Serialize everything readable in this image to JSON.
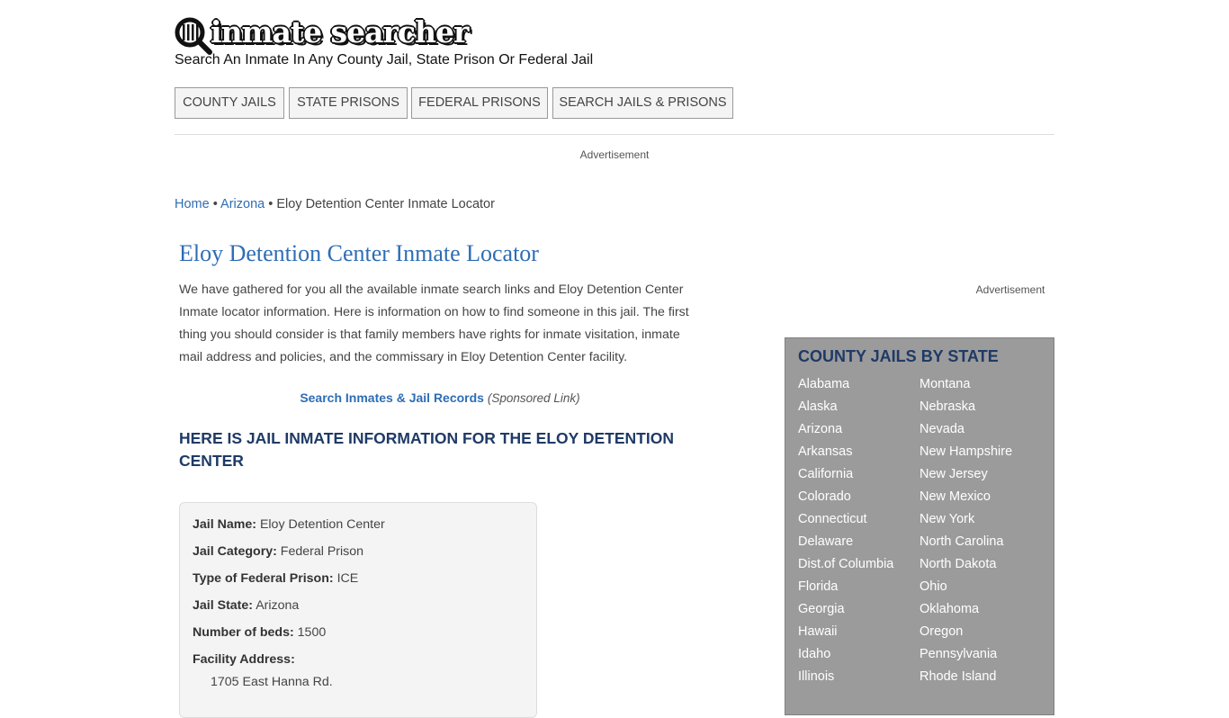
{
  "header": {
    "logo_text": "inmate searcher",
    "tagline": "Search An Inmate In Any County Jail, State Prison Or Federal Jail"
  },
  "nav": {
    "items": [
      "County Jails",
      "State Prisons",
      "Federal Prisons",
      "Search Jails & Prisons"
    ]
  },
  "ads": {
    "top": "Advertisement",
    "sidebar": "Advertisement"
  },
  "breadcrumb": {
    "home": "Home",
    "state": "Arizona",
    "current": "Eloy Detention Center Inmate Locator",
    "sep": "•"
  },
  "main": {
    "title": "Eloy Detention Center Inmate Locator",
    "intro": "We have gathered for you all the available inmate search links and Eloy Detention Center Inmate locator information. Here is information on how to find someone in this jail. The first thing you should consider is that family members have rights for inmate visitation, inmate mail address and policies, and the commissary in Eloy Detention Center facility.",
    "sponsor_link": "Search Inmates & Jail Records",
    "sponsor_note": "(Sponsored Link)",
    "info_heading": "Here is Jail Inmate Information for the Eloy Detention Center"
  },
  "info": {
    "jail_name_label": "Jail Name:",
    "jail_name": "Eloy Detention Center",
    "category_label": "Jail Category:",
    "category": "Federal Prison",
    "type_label": "Type of Federal Prison:",
    "type": "ICE",
    "state_label": "Jail State:",
    "state": "Arizona",
    "beds_label": "Number of beds:",
    "beds": "1500",
    "address_label": "Facility Address:",
    "address_line1": "1705 East Hanna Rd."
  },
  "sidebar": {
    "title": "County Jails by State",
    "left": [
      "Alabama",
      "Alaska",
      "Arizona",
      "Arkansas",
      "California",
      "Colorado",
      "Connecticut",
      "Delaware",
      "Dist.of Columbia",
      "Florida",
      "Georgia",
      "Hawaii",
      "Idaho",
      "Illinois"
    ],
    "right": [
      "Montana",
      "Nebraska",
      "Nevada",
      "New Hampshire",
      "New Jersey",
      "New Mexico",
      "New York",
      "North Carolina",
      "North Dakota",
      "Ohio",
      "Oklahoma",
      "Oregon",
      "Pennsylvania",
      "Rhode Island"
    ]
  },
  "colors": {
    "link": "#2e6db4",
    "heading": "#1f3a66",
    "sidebar_bg": "#9b9b9b"
  }
}
